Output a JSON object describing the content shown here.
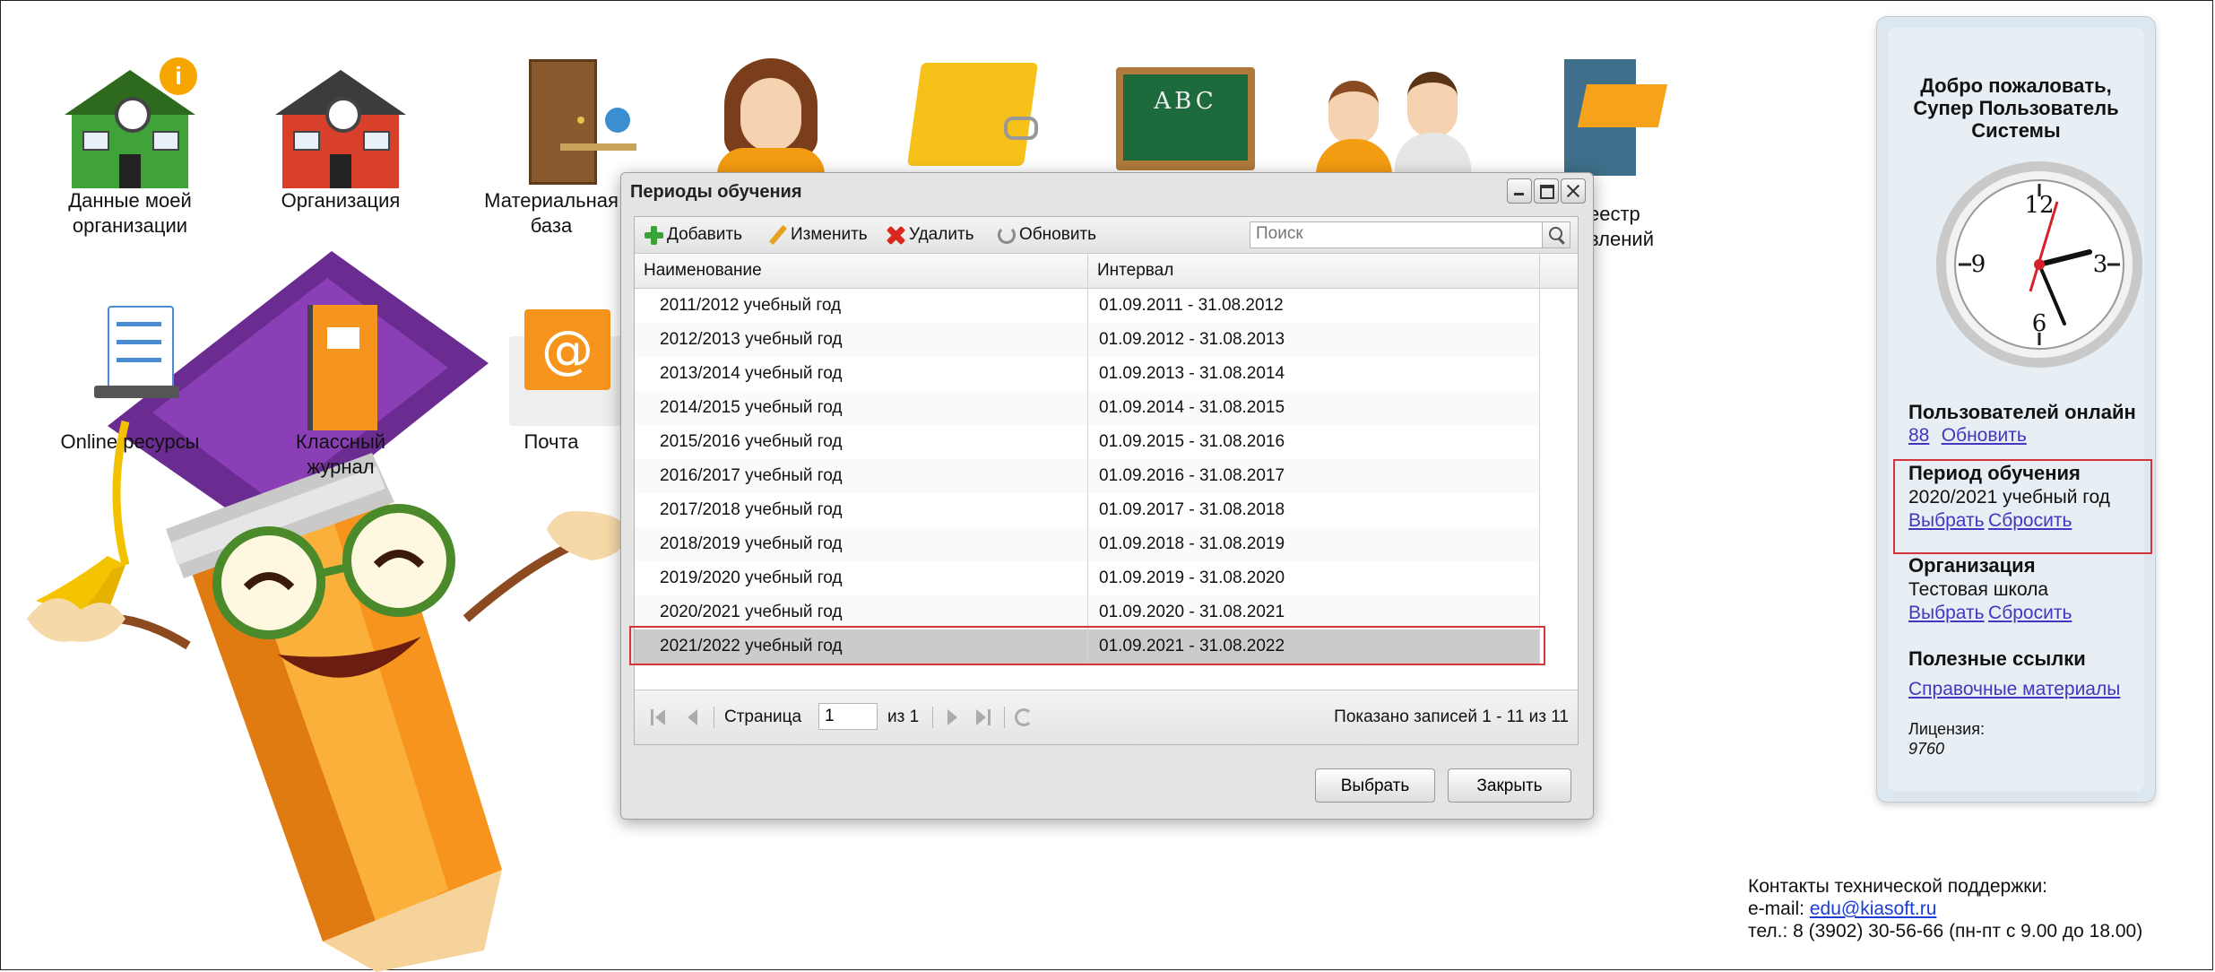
{
  "desktop": {
    "icons": [
      {
        "label_line1": "Данные моей",
        "label_line2": "организации"
      },
      {
        "label_line1": "Организация",
        "label_line2": ""
      },
      {
        "label_line1": "Материальная",
        "label_line2": "база"
      },
      {
        "label_line1": "еестр",
        "label_line2": "влений"
      },
      {
        "label_line1": "Online ресурсы",
        "label_line2": ""
      },
      {
        "label_line1": "Классный",
        "label_line2": "журнал"
      },
      {
        "label_line1": "Почта",
        "label_line2": ""
      }
    ],
    "chalkboard_text": "ABC",
    "icon_names": [
      "my-organization-house-icon",
      "organization-house-icon",
      "door-desk-icon",
      "student-girl-icon",
      "folder-icon",
      "chalkboard-icon",
      "people-icon",
      "file-cabinet-icon",
      "laptop-checklist-icon",
      "journal-icon",
      "mail-icon"
    ]
  },
  "modal": {
    "title": "Периоды обучения",
    "toolbar": {
      "add": "Добавить",
      "edit": "Изменить",
      "delete": "Удалить",
      "refresh": "Обновить",
      "search_placeholder": "Поиск"
    },
    "columns": [
      "Наименование",
      "Интервал"
    ],
    "rows": [
      {
        "name": "2011/2012 учебный год",
        "interval": "01.09.2011 - 31.08.2012"
      },
      {
        "name": "2012/2013 учебный год",
        "interval": "01.09.2012 - 31.08.2013"
      },
      {
        "name": "2013/2014 учебный год",
        "interval": "01.09.2013 - 31.08.2014"
      },
      {
        "name": "2014/2015 учебный год",
        "interval": "01.09.2014 - 31.08.2015"
      },
      {
        "name": "2015/2016 учебный год",
        "interval": "01.09.2015 - 31.08.2016"
      },
      {
        "name": "2016/2017 учебный год",
        "interval": "01.09.2016 - 31.08.2017"
      },
      {
        "name": "2017/2018 учебный год",
        "interval": "01.09.2017 - 31.08.2018"
      },
      {
        "name": "2018/2019 учебный год",
        "interval": "01.09.2018 - 31.08.2019"
      },
      {
        "name": "2019/2020 учебный год",
        "interval": "01.09.2019 - 31.08.2020"
      },
      {
        "name": "2020/2021 учебный год",
        "interval": "01.09.2020 - 31.08.2021"
      },
      {
        "name": "2021/2022 учебный год",
        "interval": "01.09.2021 - 31.08.2022",
        "selected": true
      }
    ],
    "pager": {
      "page_label": "Страница",
      "page_value": "1",
      "of_label": "из 1",
      "summary": "Показано записей 1 - 11 из 11"
    },
    "buttons": {
      "select": "Выбрать",
      "close": "Закрыть"
    }
  },
  "sidebar": {
    "welcome_line1": "Добро пожаловать,",
    "welcome_line2": "Супер Пользователь",
    "welcome_line3": "Системы",
    "clock_numerals": {
      "n12": "12",
      "n3": "3",
      "n6": "6",
      "n9": "9"
    },
    "users_online": {
      "title": "Пользователей онлайн",
      "count": "88",
      "refresh": "Обновить"
    },
    "period": {
      "title": "Период обучения",
      "value": "2020/2021 учебный год",
      "select": "Выбрать",
      "reset": "Сбросить"
    },
    "organization": {
      "title": "Организация",
      "value": "Тестовая школа",
      "select": "Выбрать",
      "reset": "Сбросить"
    },
    "links": {
      "title": "Полезные ссылки",
      "reference": "Справочные материалы"
    },
    "license": {
      "label": "Лицензия:",
      "value": "9760"
    }
  },
  "support": {
    "line1": "Контакты технической поддержки:",
    "email_label": "e-mail: ",
    "email": "edu@kiasoft.ru",
    "phone": "тел.: 8 (3902) 30-56-66 (пн-пт с 9.00 до 18.00)"
  },
  "colors": {
    "accent_red": "#d6343c",
    "link": "#4038c0",
    "selected_row": "#cbcbcb",
    "sidebar_bg": "#dce7ef"
  }
}
